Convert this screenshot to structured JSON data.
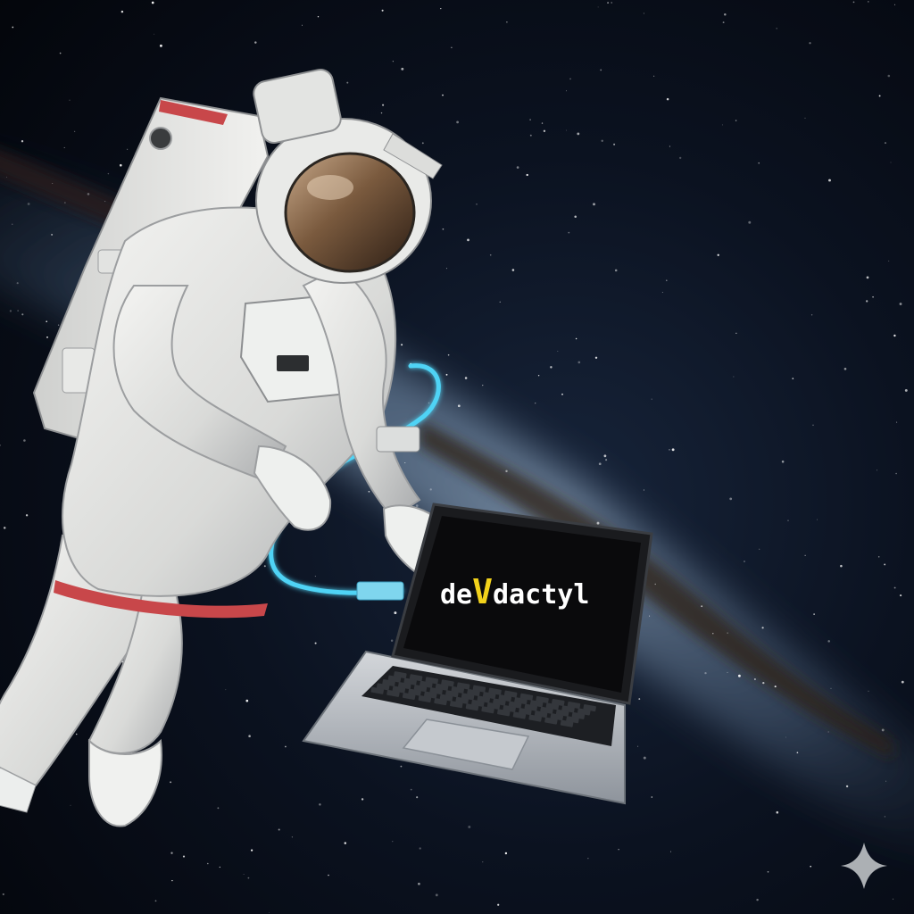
{
  "laptop_screen": {
    "logo": {
      "part_before": "de",
      "part_accent": "V",
      "part_after": "dactyl"
    }
  },
  "colors": {
    "space_background": "#05070c",
    "logo_text": "#ffffff",
    "logo_accent": "#f2d21b",
    "tether_cable": "#4fd3f5",
    "suit_stripe": "#c8474a",
    "laptop_screen": "#0a0a0c",
    "laptop_body": "#b9bdc3"
  },
  "icons": {
    "corner_sparkle": "sparkle-icon"
  }
}
